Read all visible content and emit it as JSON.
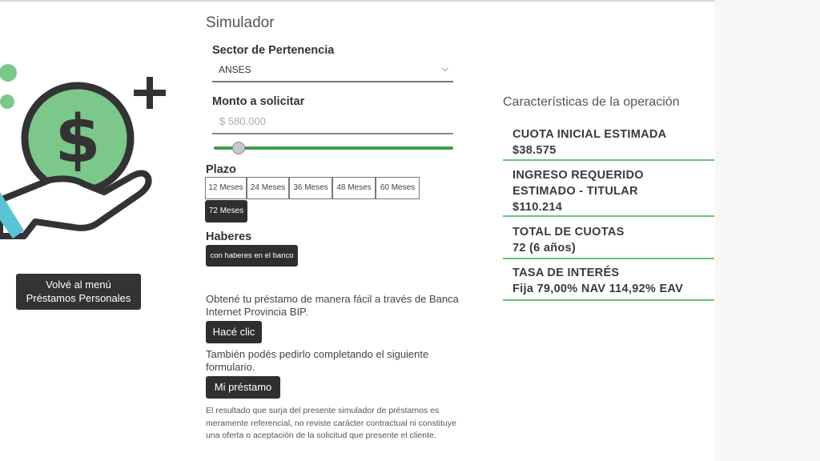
{
  "nav": {
    "back_line1": "Volvé al menú",
    "back_line2": "Préstamos Personales"
  },
  "simulador": {
    "title": "Simulador",
    "sector_label": "Sector de Pertenencia",
    "sector_value": "ANSES",
    "monto_label": "Monto a solicitar",
    "monto_placeholder": "$ 580.000",
    "monto_slider_fraction": 0.08,
    "plazo_label": "Plazo",
    "plazo_options": [
      "12 Meses",
      "24 Meses",
      "36 Meses",
      "48 Meses",
      "60 Meses",
      "72 Meses"
    ],
    "plazo_selected": "72 Meses",
    "haberes_label": "Haberes",
    "haberes_option": "con haberes en el banco",
    "bip_text": "Obtené tu préstamo de manera fácil a través de Banca Internet Provincia BIP.",
    "bip_button": "Hacé clic",
    "form_text": "También podés pedirlo completando el siguiente formulario.",
    "form_button": "Mi préstamo",
    "disclaimer": "El resultado que surja del presente simulador de préstamos es meramente referencial, no reviste carácter contractual ni constituye una oferta o aceptación de la solicitud que presente el cliente."
  },
  "operacion": {
    "title": "Características de la operación",
    "items": [
      {
        "key": "CUOTA INICIAL ESTIMADA",
        "value": "$38.575"
      },
      {
        "key": "INGRESO REQUERIDO ESTIMADO - TITULAR",
        "value": "$110.214"
      },
      {
        "key": "TOTAL DE CUOTAS",
        "value": "72 (6 años)"
      },
      {
        "key": "TASA DE INTERÉS",
        "value": "Fija 79,00% NAV 114,92% EAV"
      }
    ]
  },
  "colors": {
    "accent_green": "#3a9d4a",
    "dark_button": "#2f2f2f",
    "illustration_green": "#7cc88a"
  },
  "icons": {
    "illustration": "hand-holding-dollar-coin-icon",
    "dropdown": "chevron-down-icon",
    "plus": "plus-icon"
  }
}
